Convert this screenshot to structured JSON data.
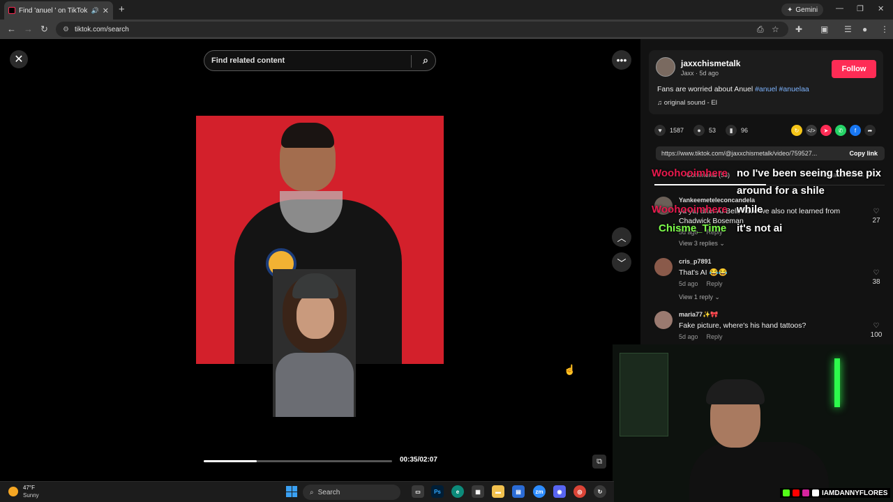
{
  "browser": {
    "tab_title": "Find 'anuel ' on TikTok | TikTok",
    "new_tab": "+",
    "gemini_label": "Gemini",
    "url": "tiktok.com/search"
  },
  "search": {
    "placeholder": "Find related content"
  },
  "video": {
    "time": "00:35/02:07",
    "progress": 0.283
  },
  "author": {
    "username": "jaxxchismetalk",
    "display_name": "Jaxx",
    "posted": "5d ago",
    "follow_label": "Follow",
    "caption_text": "Fans are worried about Anuel ",
    "hashtag_1": "#anuel",
    "hashtag_2": "#anuelaa",
    "sound": "original sound - El"
  },
  "stats": {
    "likes": "1587",
    "comments": "53",
    "saves": "96"
  },
  "link": {
    "url": "https://www.tiktok.com/@jaxxchismetalk/video/759527...",
    "copy_label": "Copy link"
  },
  "comments_tab": {
    "label": "Comments (53)",
    "creator_videos": "Creator videos"
  },
  "comments": [
    {
      "user": "Yankeemeteleconcandela",
      "text": "ya ya, after AI Bell, have we also not learned from Chadwick Boseman",
      "date": "5d ago",
      "reply": "Reply",
      "view_replies": "View 3 replies",
      "likes": "27"
    },
    {
      "user": "cris_p7891",
      "text": "That's AI 😂😂",
      "date": "5d ago",
      "reply": "Reply",
      "view_replies": "View 1 reply",
      "likes": "38"
    },
    {
      "user": "maria77✨🎀",
      "text": "Fake picture, where's his hand tattoos?",
      "date": "5d ago",
      "reply": "Reply",
      "likes": "100"
    }
  ],
  "stream_chat": {
    "user_1": "Woohooimhere",
    "msg_1a": "no I've been seeing these pix",
    "msg_1b": "around for a shile",
    "user_2": "Woohooimhere",
    "msg_2": "while",
    "user_3": "Chisme_Time",
    "msg_3": "it's not ai",
    "colors": {
      "user_1": "#e8194d",
      "user_2": "#e8194d",
      "user_3": "#7dff4a"
    }
  },
  "webcam": {
    "handle": "IAMDANNYFLORES"
  },
  "taskbar": {
    "temp": "47°F",
    "condition": "Sunny",
    "search_label": "Search"
  },
  "icons": {
    "close": "close-icon",
    "search": "search-icon",
    "more": "more-icon",
    "up": "chevron-up-icon",
    "down": "chevron-down-icon"
  },
  "colors": {
    "accent": "#fe2c55",
    "hashtag": "#7db4ff",
    "photo_bg": "#d3202b"
  }
}
